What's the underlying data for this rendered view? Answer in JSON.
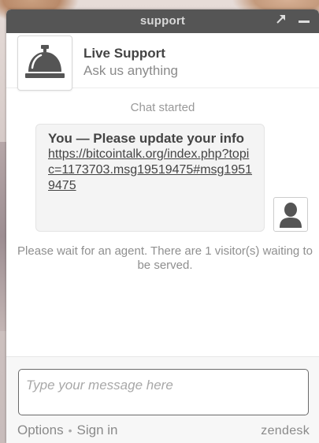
{
  "window": {
    "title": "support",
    "popout_icon": "popout-arrow-icon",
    "minimize_icon": "minimize-icon"
  },
  "header": {
    "avatar_icon": "service-bell-icon",
    "name": "Live Support",
    "tagline": "Ask us anything"
  },
  "chat": {
    "started_text": "Chat started",
    "message": {
      "header": "You — Please update your info",
      "link": "https://bitcointalk.org/index.php?topic=1173703.msg19519475#msg19519475",
      "avatar_icon": "user-silhouette-icon"
    },
    "wait_note": "Please wait for an agent. There are 1 visitor(s) waiting to be served."
  },
  "composer": {
    "placeholder": "Type your message here",
    "value": ""
  },
  "footer": {
    "options_label": "Options",
    "separator": "•",
    "signin_label": "Sign in",
    "brand": "zendesk"
  },
  "colors": {
    "titlebar": "#555555",
    "bubble": "#f4f4f4",
    "text_dark": "#444444",
    "text_muted": "#8a8a8a"
  }
}
